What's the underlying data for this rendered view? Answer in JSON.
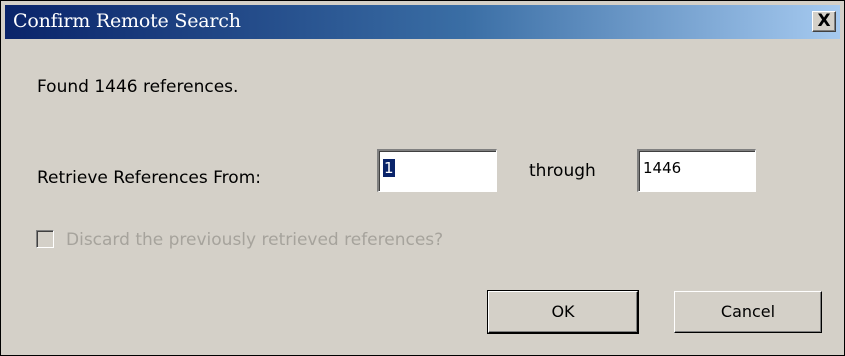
{
  "window": {
    "title": "Confirm Remote Search",
    "close_label": "X"
  },
  "dialog": {
    "found_text": "Found 1446 references.",
    "retrieve_label": "Retrieve References From:",
    "from_value": "1",
    "through_label": "through",
    "to_value": "1446",
    "discard_checkbox_label": "Discard the previously retrieved references?",
    "discard_checked": false,
    "discard_enabled": false
  },
  "buttons": {
    "ok_label": "OK",
    "cancel_label": "Cancel"
  },
  "colors": {
    "titlebar_start": "#0a246a",
    "titlebar_end": "#a6caf0",
    "dialog_background": "#d4d0c8",
    "disabled_text": "#a6a39c"
  }
}
